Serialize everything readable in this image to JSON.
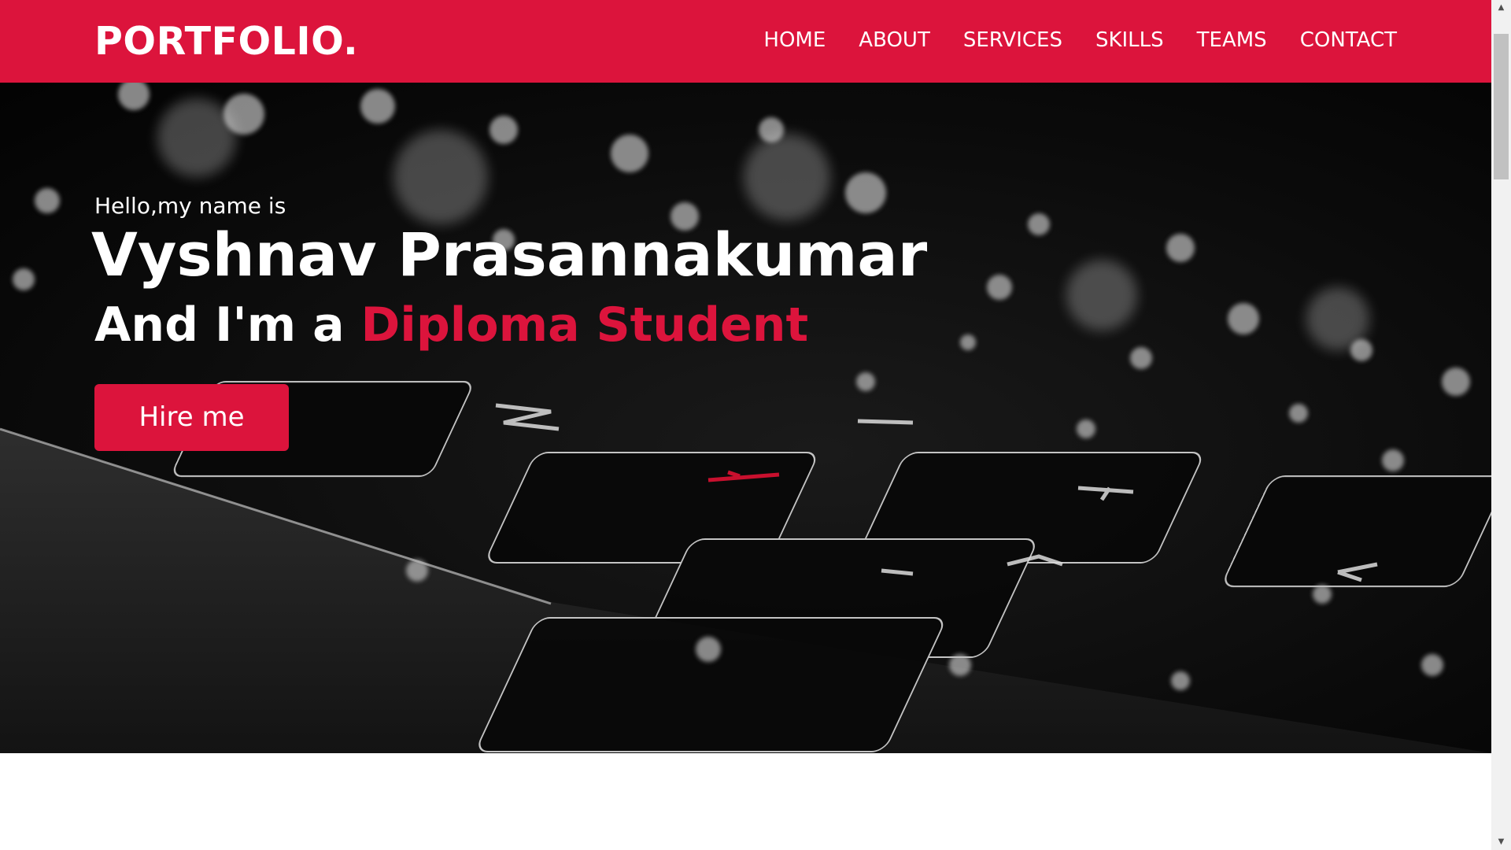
{
  "brand": {
    "logo": "PORTFOLIO."
  },
  "nav": {
    "items": [
      {
        "label": "HOME"
      },
      {
        "label": "ABOUT"
      },
      {
        "label": "SERVICES"
      },
      {
        "label": "SKILLS"
      },
      {
        "label": "TEAMS"
      },
      {
        "label": "CONTACT"
      }
    ]
  },
  "hero": {
    "greeting": "Hello,my name is",
    "name": "Vyshnav Prasannakumar",
    "role_prefix": "And I'm a ",
    "role": "Diploma Student",
    "cta_label": "Hire me"
  },
  "colors": {
    "accent": "#dc143c",
    "hero_bg": "#060606",
    "text_light": "#ffffff"
  },
  "scrollbar": {
    "up_icon": "scroll-up-arrow-icon",
    "down_icon": "scroll-down-arrow-icon"
  }
}
